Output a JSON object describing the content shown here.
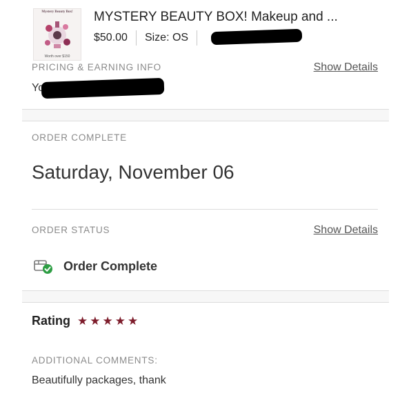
{
  "product": {
    "thumbnail_title": "Mystery Beauty Box!",
    "thumbnail_footer": "Worth over $150",
    "title": "MYSTERY BEAUTY BOX! Makeup and ...",
    "price": "$50.00",
    "size": "Size: OS"
  },
  "pricing": {
    "label": "PRICING & EARNING INFO",
    "show_details": "Show Details",
    "earning_prefix": "Yo"
  },
  "order_complete": {
    "label": "ORDER COMPLETE",
    "date": "Saturday, November 06"
  },
  "order_status": {
    "label": "ORDER STATUS",
    "show_details": "Show Details",
    "status": "Order Complete",
    "icon": "package-check-icon",
    "check_color": "#2e9e44"
  },
  "rating": {
    "label": "Rating",
    "stars": 5,
    "star_color": "#7d1c2b"
  },
  "comments": {
    "label": "ADDITIONAL COMMENTS:",
    "text": "Beautifully packages, thank"
  }
}
